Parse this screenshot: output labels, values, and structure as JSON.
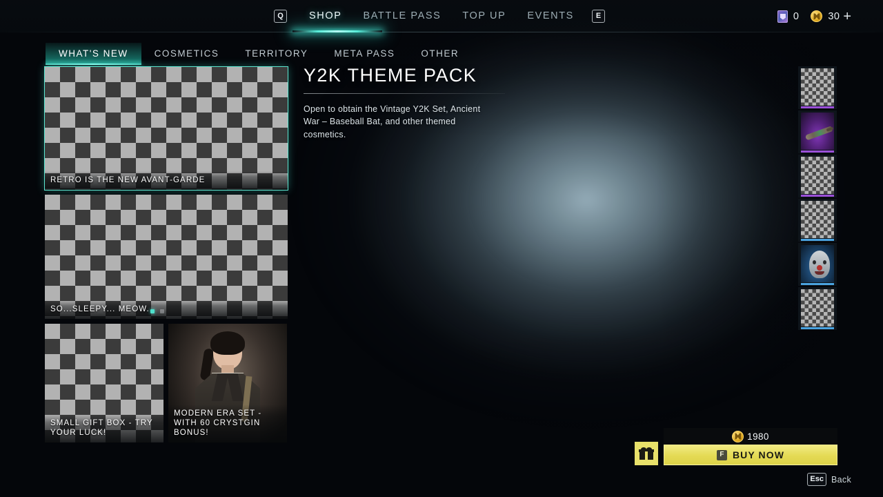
{
  "topbar": {
    "left_key": "Q",
    "right_key": "E",
    "tabs": [
      {
        "label": "SHOP",
        "active": true
      },
      {
        "label": "BATTLE PASS",
        "active": false
      },
      {
        "label": "TOP UP",
        "active": false
      },
      {
        "label": "EVENTS",
        "active": false
      }
    ],
    "currency": {
      "ticket_icon": "ticket-icon",
      "ticket_value": "0",
      "coin_icon": "coin-icon",
      "coin_value": "30",
      "add_label": "+"
    }
  },
  "category_tabs": [
    {
      "label": "WHAT'S NEW",
      "active": true
    },
    {
      "label": "COSMETICS",
      "active": false
    },
    {
      "label": "TERRITORY",
      "active": false
    },
    {
      "label": "META PASS",
      "active": false
    },
    {
      "label": "OTHER",
      "active": false
    }
  ],
  "cards": {
    "hero": {
      "label": "RETRO IS THE NEW AVANT-GARDE",
      "selected": true
    },
    "second": {
      "label": "SO...SLEEPY... MEOW...",
      "selected": false
    },
    "small_left": {
      "label": "SMALL GIFT BOX - TRY YOUR LUCK!",
      "selected": false
    },
    "small_right": {
      "label": "MODERN ERA SET - WITH 60 CRYSTGIN BONUS!",
      "selected": false
    }
  },
  "detail": {
    "title": "Y2K THEME PACK",
    "description": "Open to obtain the Vintage Y2K Set, Ancient War – Baseball Bat, and other themed cosmetics."
  },
  "rail": {
    "items": [
      {
        "name": "item-thumb-1",
        "art": "placeholder",
        "rarity": "#9b4fd8"
      },
      {
        "name": "item-thumb-2",
        "art": "baseball-bat",
        "rarity": "#9b4fd8"
      },
      {
        "name": "item-thumb-3",
        "art": "placeholder",
        "rarity": "#9b4fd8"
      },
      {
        "name": "item-thumb-4",
        "art": "placeholder",
        "rarity": "#4aa3e0"
      },
      {
        "name": "item-thumb-5",
        "art": "clown-mask",
        "rarity": "#4aa3e0"
      },
      {
        "name": "item-thumb-6",
        "art": "placeholder",
        "rarity": "#4aa3e0"
      }
    ]
  },
  "purchase": {
    "gift_icon": "gift-icon",
    "price": "1980",
    "price_icon": "coin-icon",
    "buy_key": "F",
    "buy_label": "BUY NOW"
  },
  "footer": {
    "key": "Esc",
    "label": "Back"
  },
  "colors": {
    "accent_teal": "#5de8d2",
    "buy_yellow": "#e4da54",
    "rarity_epic": "#9b4fd8",
    "rarity_rare": "#4aa3e0",
    "coin_gold": "#e0a91d"
  }
}
